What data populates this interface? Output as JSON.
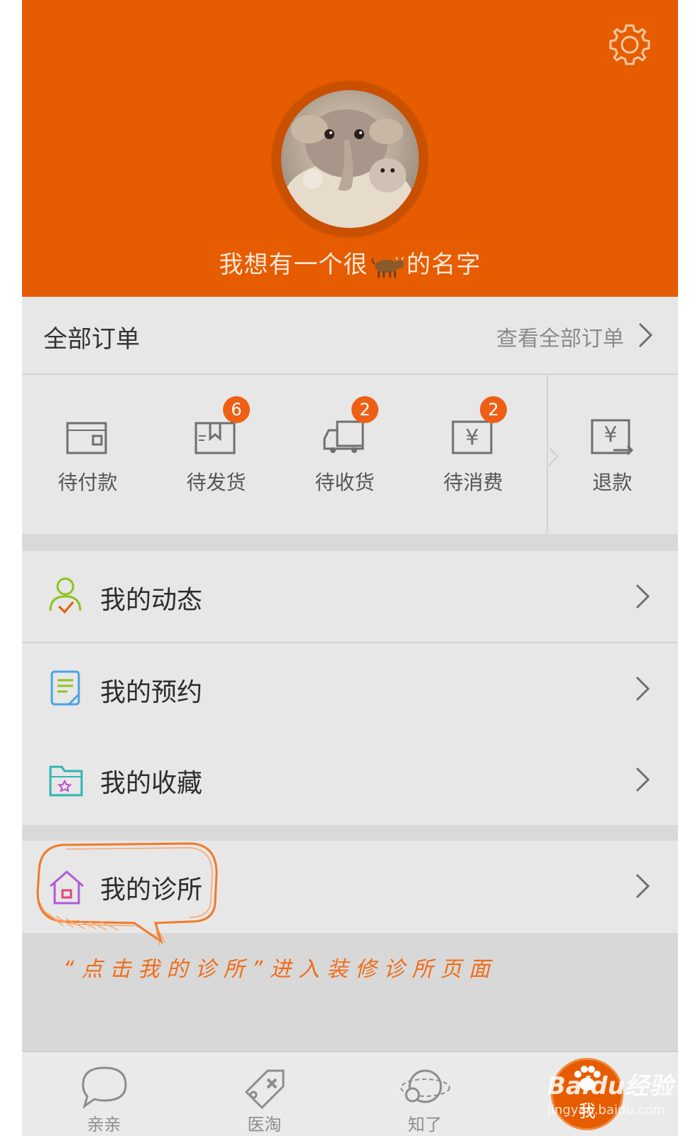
{
  "profile": {
    "username_before": "我想有一个很",
    "username_after": "的名字",
    "username_emoji": "cow-emoji"
  },
  "orders": {
    "title": "全部订单",
    "view_all": "查看全部订单",
    "statuses": [
      {
        "label": "待付款",
        "icon": "wallet-icon",
        "badge": null
      },
      {
        "label": "待发货",
        "icon": "package-icon",
        "badge": "6"
      },
      {
        "label": "待收货",
        "icon": "truck-icon",
        "badge": "2"
      },
      {
        "label": "待消费",
        "icon": "yen-ticket-icon",
        "badge": "2"
      },
      {
        "label": "退款",
        "icon": "refund-icon",
        "badge": null
      }
    ]
  },
  "menu": {
    "items": [
      {
        "label": "我的动态",
        "icon": "user-activity-icon"
      },
      {
        "label": "我的预约",
        "icon": "appointment-icon"
      },
      {
        "label": "我的收藏",
        "icon": "favorites-folder-icon"
      },
      {
        "label": "我的诊所",
        "icon": "clinic-house-icon"
      }
    ]
  },
  "annotation": "“点击我的诊所”进入装修诊所页面",
  "tabbar": {
    "tabs": [
      {
        "label": "亲亲",
        "icon": "chat-bubble-icon"
      },
      {
        "label": "医淘",
        "icon": "tag-icon"
      },
      {
        "label": "知了",
        "icon": "planet-icon"
      },
      {
        "label": "我",
        "icon": "paw-icon"
      }
    ]
  },
  "watermark": {
    "brand": "Baidu经验",
    "url": "jingyan.baidu.com"
  },
  "colors": {
    "primary": "#e65c00",
    "badge": "#ee5f16",
    "annotation": "#f06d1a",
    "background": "#e4e4e4"
  }
}
